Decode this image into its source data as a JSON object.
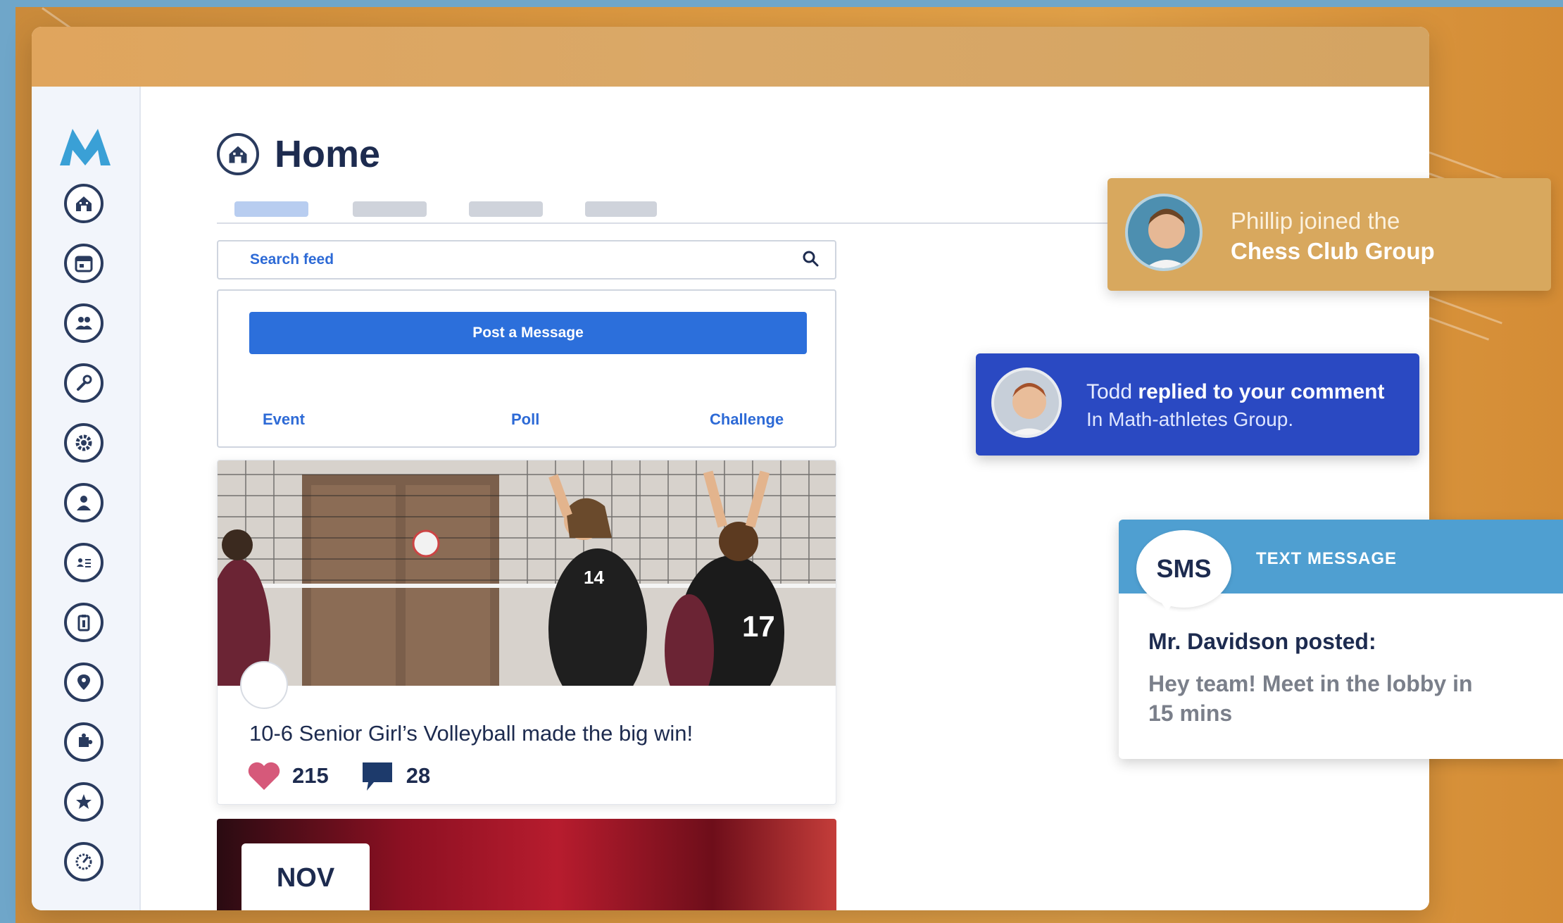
{
  "colors": {
    "background": "#d8953f",
    "brand_dark": "#1d2b4f",
    "brand_blue": "#2c6fdb",
    "notification_gold": "#d8a85e",
    "notification_blue": "#2a49c2",
    "sms_header": "#4f9fd1"
  },
  "sidebar": {
    "logo": "M",
    "items": [
      {
        "icon": "home-icon"
      },
      {
        "icon": "calendar-icon"
      },
      {
        "icon": "groups-icon"
      },
      {
        "icon": "wrench-icon"
      },
      {
        "icon": "settings-icon"
      },
      {
        "icon": "user-icon"
      },
      {
        "icon": "directory-icon"
      },
      {
        "icon": "clipboard-icon"
      },
      {
        "icon": "location-icon"
      },
      {
        "icon": "puzzle-icon"
      },
      {
        "icon": "star-icon"
      },
      {
        "icon": "dashboard-icon"
      }
    ]
  },
  "header": {
    "title": "Home",
    "icon": "home-icon"
  },
  "search": {
    "placeholder": "Search feed"
  },
  "composer": {
    "post_label": "Post a Message",
    "types": [
      "Event",
      "Poll",
      "Challenge"
    ]
  },
  "feed": {
    "post": {
      "caption": "10-6 Senior Girl’s Volleyball made the big win!",
      "likes": "215",
      "comments": "28"
    },
    "event": {
      "month": "NOV"
    }
  },
  "notifications": {
    "chess": {
      "line1": "Phillip joined the",
      "line2": "Chess Club Group"
    },
    "todd": {
      "name": "Todd",
      "action": "replied to your comment",
      "line2": "In Math-athletes Group."
    },
    "sms": {
      "badge": "SMS",
      "type": "TEXT MESSAGE",
      "title": "Mr. Davidson posted:",
      "body": "Hey team! Meet in the lobby in 15 mins"
    }
  }
}
